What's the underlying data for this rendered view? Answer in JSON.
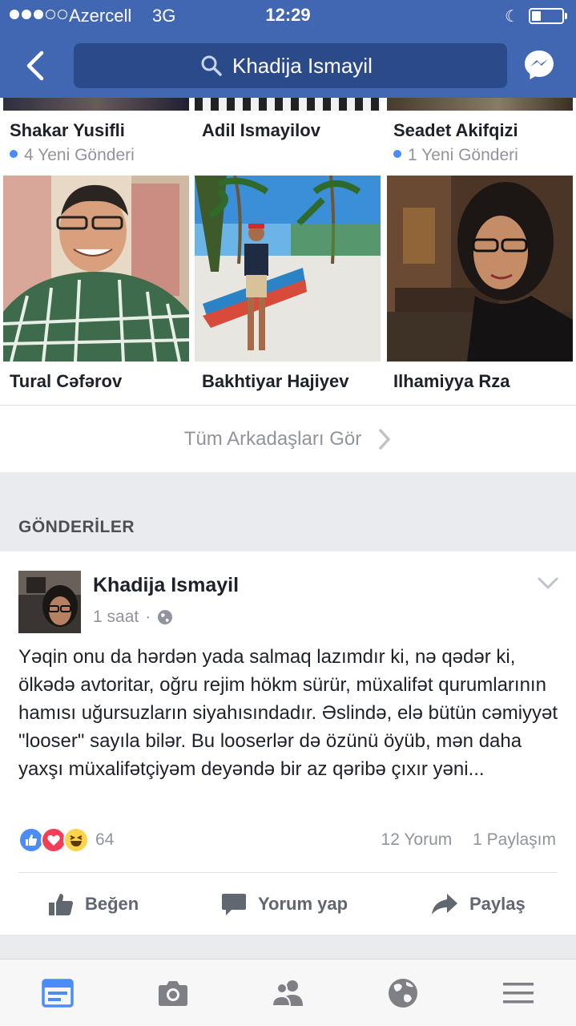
{
  "status": {
    "carrier": "Azercell",
    "network": "3G",
    "time": "12:29",
    "battery_level": 0.3
  },
  "header": {
    "search_text": "Khadija Ismayil"
  },
  "friends": [
    {
      "name": "Shakar Yusifli",
      "meta": "4 Yeni Gönderi"
    },
    {
      "name": "Adil Ismayilov",
      "meta": ""
    },
    {
      "name": "Seadet Akifqizi",
      "meta": "1 Yeni Gönderi"
    },
    {
      "name": "Tural Cəfərov"
    },
    {
      "name": "Bakhtiyar Hajiyev"
    },
    {
      "name": "Ilhamiyya Rza"
    }
  ],
  "see_all": {
    "label": "Tüm Arkadaşları Gör"
  },
  "posts_section": {
    "title": "GÖNDERİLER"
  },
  "post": {
    "author": "Khadija Ismayil",
    "time": "1 saat",
    "text": "Yəqin onu da hərdən yada salmaq lazımdır ki, nə qədər ki, ölkədə avtoritar, oğru rejim hökm sürür, müxalifət qurumlarının hamısı uğursuzların siyahısındadır. Əslində, elə bütün cəmiyyət \"looser\" sayıla bilər. Bu looserlər də özünü öyüb, mən daha yaxşı müxalifətçiyəm deyəndə bir az qəribə çıxır yəni...",
    "reaction_count": "64",
    "comments": "12 Yorum",
    "shares": "1 Paylaşım",
    "actions": {
      "like": "Beğen",
      "comment": "Yorum yap",
      "share": "Paylaş"
    }
  },
  "colors": {
    "brand": "#4267b2",
    "muted": "#90949c",
    "link_dot": "#4a8df8"
  },
  "icons": [
    "back-icon",
    "search-icon",
    "messenger-icon",
    "globe-icon",
    "chevron-down-icon",
    "like-icon",
    "comment-icon",
    "share-icon",
    "news-feed-icon",
    "camera-icon",
    "friends-icon",
    "globe-tab-icon",
    "menu-icon"
  ]
}
